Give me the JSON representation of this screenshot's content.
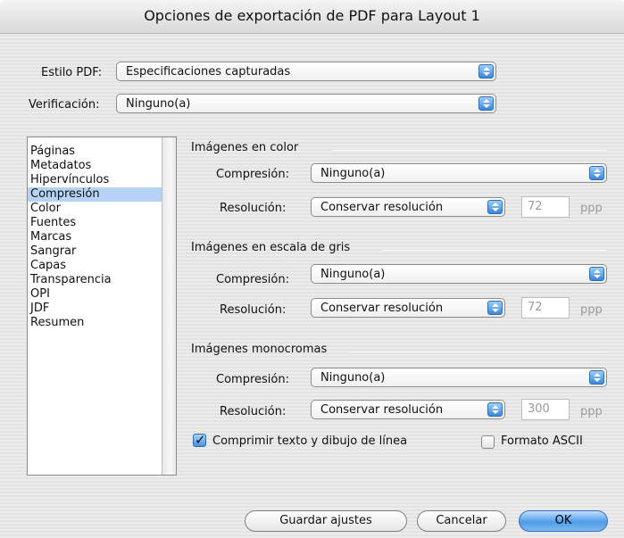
{
  "title": "Opciones de exportación de PDF para Layout 1",
  "estilo": {
    "label": "Estilo PDF:",
    "value": "Especificaciones capturadas"
  },
  "verificacion": {
    "label": "Verificación:",
    "value": "Ninguno(a)"
  },
  "sidebar": {
    "items": [
      "Páginas",
      "Metadatos",
      "Hipervínculos",
      "Compresión",
      "Color",
      "Fuentes",
      "Marcas",
      "Sangrar",
      "Capas",
      "Transparencia",
      "OPI",
      "JDF",
      "Resumen"
    ],
    "selected": "Compresión"
  },
  "sections": [
    {
      "title": "Imágenes en color",
      "compression_label": "Compresión:",
      "compression": "Ninguno(a)",
      "resolution_label": "Resolución:",
      "resolution": "Conservar resolución",
      "ppp_value": "72",
      "ppp_unit": "ppp"
    },
    {
      "title": "Imágenes en escala de gris",
      "compression_label": "Compresión:",
      "compression": "Ninguno(a)",
      "resolution_label": "Resolución:",
      "resolution": "Conservar resolución",
      "ppp_value": "72",
      "ppp_unit": "ppp"
    },
    {
      "title": "Imágenes monocromas",
      "compression_label": "Compresión:",
      "compression": "Ninguno(a)",
      "resolution_label": "Resolución:",
      "resolution": "Conservar resolución",
      "ppp_value": "300",
      "ppp_unit": "ppp"
    }
  ],
  "options": {
    "compress_text": {
      "label": "Comprimir texto y dibujo de línea",
      "checked": true
    },
    "ascii": {
      "label": "Formato ASCII",
      "checked": false
    }
  },
  "buttons": {
    "save": "Guardar ajustes",
    "cancel": "Cancelar",
    "ok": "OK"
  },
  "colors": {
    "accent": "#3a86da",
    "selection": "#b6d3f5"
  }
}
